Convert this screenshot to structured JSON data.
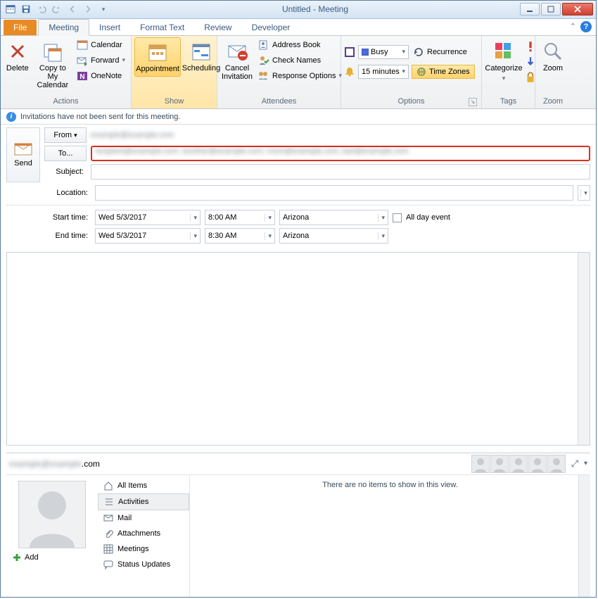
{
  "window": {
    "title": "Untitled - Meeting"
  },
  "tabs": {
    "file": "File",
    "items": [
      "Meeting",
      "Insert",
      "Format Text",
      "Review",
      "Developer"
    ],
    "active": 0
  },
  "ribbon": {
    "actions": {
      "label": "Actions",
      "delete": "Delete",
      "copy": "Copy to My\nCalendar",
      "calendar": "Calendar",
      "forward": "Forward",
      "onenote": "OneNote"
    },
    "show": {
      "label": "Show",
      "appointment": "Appointment",
      "scheduling": "Scheduling"
    },
    "attendees": {
      "label": "Attendees",
      "cancel": "Cancel\nInvitation",
      "addressbook": "Address Book",
      "checknames": "Check Names",
      "response": "Response Options"
    },
    "options": {
      "label": "Options",
      "busy": "Busy",
      "reminder": "15 minutes",
      "recurrence": "Recurrence",
      "timezones": "Time Zones"
    },
    "tags": {
      "label": "Tags",
      "categorize": "Categorize"
    },
    "zoom": {
      "label": "Zoom",
      "zoom": "Zoom"
    }
  },
  "infobar": "Invitations have not been sent for this meeting.",
  "form": {
    "send": "Send",
    "from_label": "From",
    "from_value": "example@example.com",
    "to_label": "To...",
    "to_value": "recipient@example.com; another@example.com; more@example.com; last@example.com",
    "subject_label": "Subject:",
    "subject_value": "",
    "location_label": "Location:",
    "location_value": "",
    "start_label": "Start time:",
    "end_label": "End time:",
    "start_date": "Wed 5/3/2017",
    "start_time": "8:00 AM",
    "end_date": "Wed 5/3/2017",
    "end_time": "8:30 AM",
    "tz": "Arizona",
    "allday": "All day event"
  },
  "people": {
    "email": "example@example.com",
    "add": "Add",
    "nav": [
      "All Items",
      "Activities",
      "Mail",
      "Attachments",
      "Meetings",
      "Status Updates"
    ],
    "empty": "There are no items to show in this view."
  }
}
